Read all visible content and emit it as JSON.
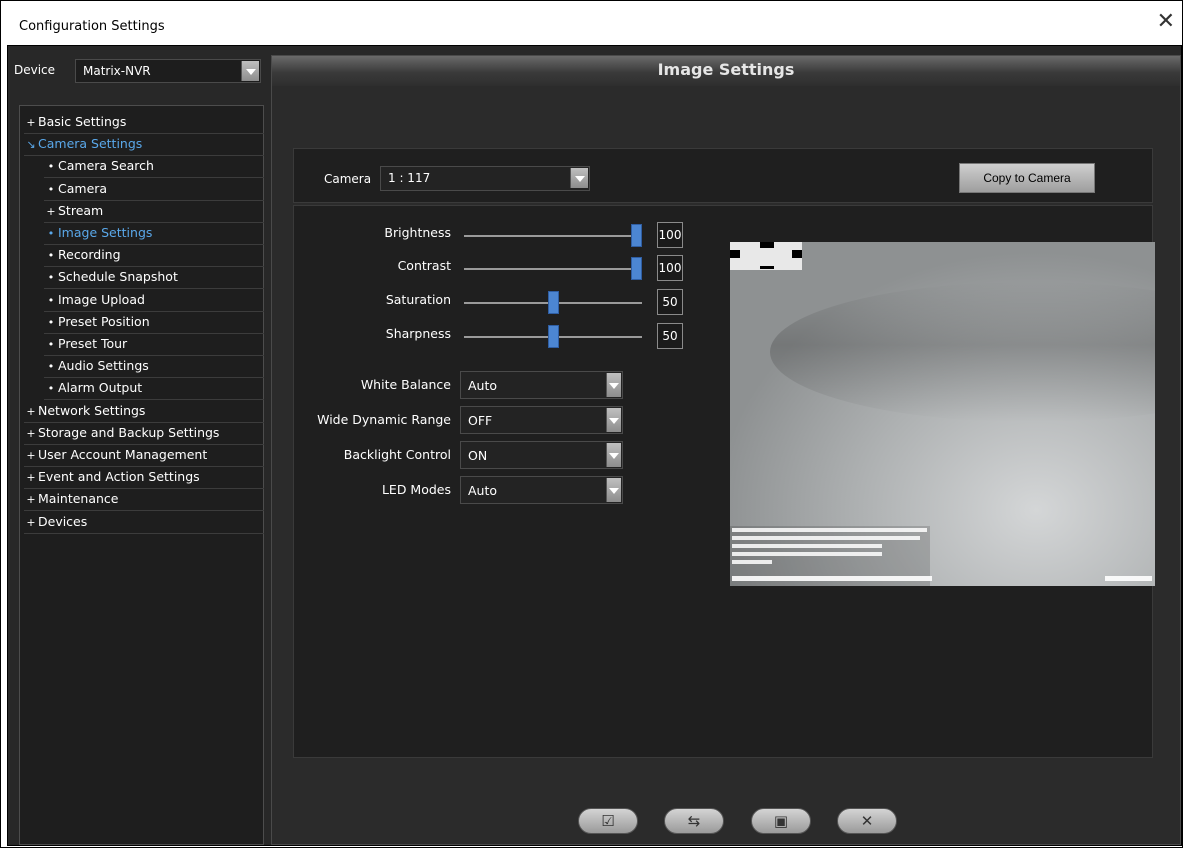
{
  "window": {
    "title": "Configuration Settings",
    "close_icon": "close-icon"
  },
  "device": {
    "label": "Device",
    "value": "Matrix-NVR"
  },
  "tree": [
    {
      "mark": "+",
      "label": "Basic Settings",
      "level": 0,
      "active": false
    },
    {
      "mark": "↘",
      "label": "Camera Settings",
      "level": 0,
      "active": true
    },
    {
      "mark": "•",
      "label": "Camera Search",
      "level": 1,
      "active": false
    },
    {
      "mark": "•",
      "label": "Camera",
      "level": 1,
      "active": false
    },
    {
      "mark": "+",
      "label": "Stream",
      "level": 1,
      "active": false
    },
    {
      "mark": "•",
      "label": "Image Settings",
      "level": 1,
      "active": true
    },
    {
      "mark": "•",
      "label": "Recording",
      "level": 1,
      "active": false
    },
    {
      "mark": "•",
      "label": "Schedule Snapshot",
      "level": 1,
      "active": false
    },
    {
      "mark": "•",
      "label": "Image Upload",
      "level": 1,
      "active": false
    },
    {
      "mark": "•",
      "label": "Preset Position",
      "level": 1,
      "active": false
    },
    {
      "mark": "•",
      "label": "Preset Tour",
      "level": 1,
      "active": false
    },
    {
      "mark": "•",
      "label": "Audio Settings",
      "level": 1,
      "active": false
    },
    {
      "mark": "•",
      "label": "Alarm Output",
      "level": 1,
      "active": false
    },
    {
      "mark": "+",
      "label": "Network Settings",
      "level": 0,
      "active": false
    },
    {
      "mark": "+",
      "label": "Storage and Backup Settings",
      "level": 0,
      "active": false
    },
    {
      "mark": "+",
      "label": "User Account Management",
      "level": 0,
      "active": false
    },
    {
      "mark": "+",
      "label": "Event and Action Settings",
      "level": 0,
      "active": false
    },
    {
      "mark": "+",
      "label": "Maintenance",
      "level": 0,
      "active": false
    },
    {
      "mark": "+",
      "label": "Devices",
      "level": 0,
      "active": false
    }
  ],
  "panel": {
    "title": "Image Settings",
    "camera_label": "Camera",
    "camera_value": "1 : 117",
    "copy_button": "Copy to Camera",
    "sliders": [
      {
        "name": "brightness",
        "label": "Brightness",
        "value": "100",
        "fraction": 1.0
      },
      {
        "name": "contrast",
        "label": "Contrast",
        "value": "100",
        "fraction": 1.0
      },
      {
        "name": "saturation",
        "label": "Saturation",
        "value": "50",
        "fraction": 0.5
      },
      {
        "name": "sharpness",
        "label": "Sharpness",
        "value": "50",
        "fraction": 0.5
      }
    ],
    "selects": [
      {
        "name": "white-balance",
        "label": "White Balance",
        "value": "Auto"
      },
      {
        "name": "wide-dynamic-range",
        "label": "Wide Dynamic Range",
        "value": "OFF"
      },
      {
        "name": "backlight-control",
        "label": "Backlight Control",
        "value": "ON"
      },
      {
        "name": "led-modes",
        "label": "LED Modes",
        "value": "Auto"
      }
    ]
  },
  "bottom_buttons": [
    {
      "name": "apply-button",
      "icon": "check-icon"
    },
    {
      "name": "refresh-button",
      "icon": "refresh-icon"
    },
    {
      "name": "save-button",
      "icon": "save-icon"
    },
    {
      "name": "cancel-button",
      "icon": "close-icon"
    }
  ]
}
